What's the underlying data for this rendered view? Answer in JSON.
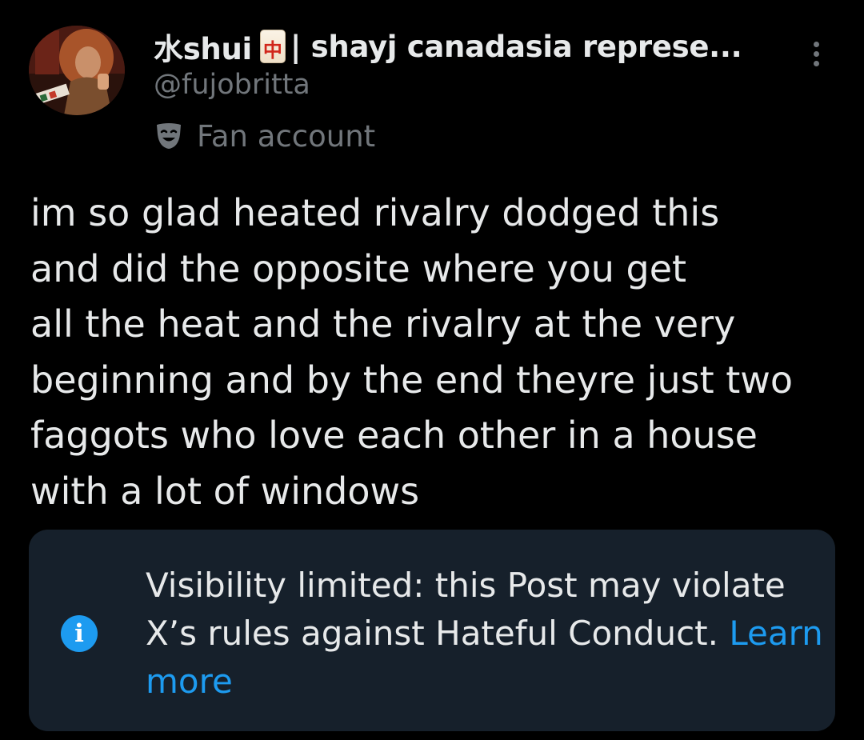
{
  "author": {
    "display_name_prefix": "水shui",
    "badge_glyph": "中",
    "display_name_suffix": "| shayj canadasia represe...",
    "handle": "@fujobritta",
    "account_label": "Fan account"
  },
  "post": {
    "lines": [
      "im so glad heated rivalry dodged this",
      "and did the opposite where you get",
      "all the heat and the rivalry at the very",
      "beginning and by the end theyre just two",
      "faggots who love each other in a house",
      "with a lot of windows"
    ]
  },
  "notice": {
    "line_1": "Visibility limited: this Post may violate",
    "line_2": "X’s rules against Hateful Conduct.",
    "learn_word": "Learn",
    "more_word": "more",
    "info_glyph": "i"
  },
  "icons": {
    "more": "more-vertical-icon",
    "label": "masks-icon",
    "info": "info-icon",
    "badge": "mahjong-tile-icon"
  },
  "colors": {
    "background": "#000000",
    "text_primary": "#e7e9ea",
    "text_secondary": "#71767b",
    "notice_background": "#16202b",
    "accent": "#1d9bf0",
    "tile_red": "#d1261b"
  }
}
